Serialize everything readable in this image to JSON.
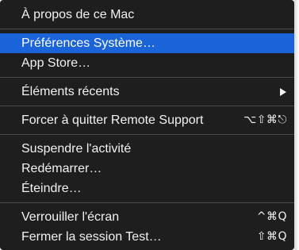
{
  "apple_menu": {
    "about": "À propos de ce Mac",
    "system_preferences": "Préférences Système…",
    "app_store": "App Store…",
    "recent_items": "Éléments récents",
    "force_quit": "Forcer à quitter Remote Support",
    "force_quit_shortcut": "⌥⇧⌘⎋",
    "sleep": "Suspendre l'activité",
    "restart": "Redémarrer…",
    "shut_down": "Éteindre…",
    "lock_screen": "Verrouiller l'écran",
    "lock_screen_shortcut": "^⌘Q",
    "log_out": "Fermer la session Test…",
    "log_out_shortcut": "⇧⌘Q"
  },
  "colors": {
    "menu_background": "#1e1e1e",
    "selection": "#1a63d8",
    "text": "#f2f2f2",
    "separator": "#4a4a4a"
  }
}
